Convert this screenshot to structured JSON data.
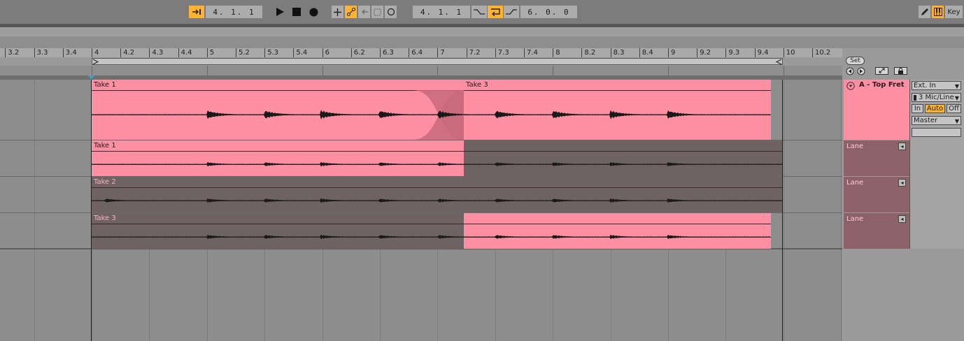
{
  "transport": {
    "position_left": "4.  1.  1",
    "loop_start": "4.  1.  1",
    "loop_length": "6.  0.  0",
    "key_label": "Key"
  },
  "ruler": {
    "labels": [
      "3.2",
      "3.3",
      "3.4",
      "4",
      "4.2",
      "4.3",
      "4.4",
      "5",
      "5.2",
      "5.3",
      "5.4",
      "6",
      "6.2",
      "6.3",
      "6.4",
      "7",
      "7.2",
      "7.3",
      "7.4",
      "8",
      "8.2",
      "8.3",
      "8.4",
      "9",
      "9.2",
      "9.3",
      "9.4",
      "10",
      "10.2"
    ]
  },
  "track": {
    "name": "A - Top Fret",
    "input_type": "Ext. In",
    "input_channel": "3 Mic/Line",
    "monitor": [
      "In",
      "Auto",
      "Off"
    ],
    "output": "Master",
    "set_label": "Set"
  },
  "clips": {
    "main_left": "Take 1",
    "main_right": "Take 3"
  },
  "lanes": [
    {
      "label": "Lane",
      "take": "Take 1"
    },
    {
      "label": "Lane",
      "take": "Take 2"
    },
    {
      "label": "Lane",
      "take": "Take 3"
    }
  ],
  "colors": {
    "clip_pink": "#ff8fa3",
    "clip_dim": "#6e6263",
    "accent": "#ffb330"
  }
}
